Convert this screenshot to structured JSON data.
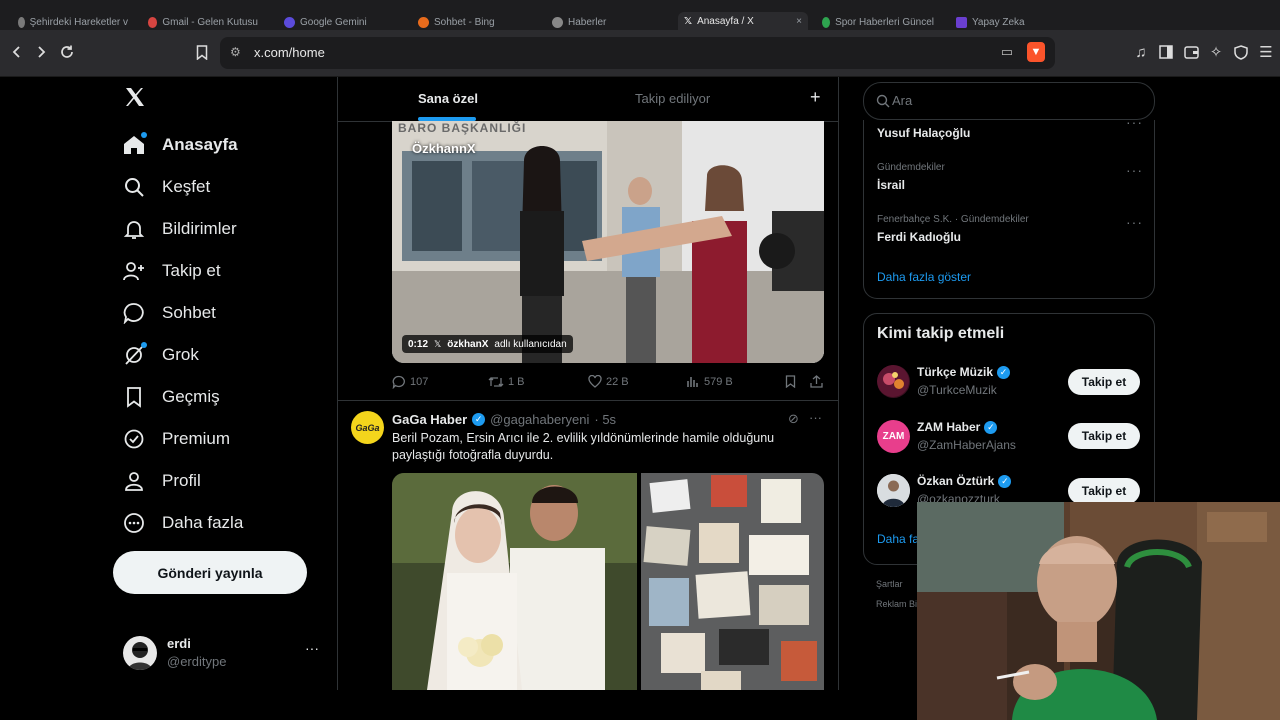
{
  "browser": {
    "tabs": [
      "Şehirdeki Hareketler v",
      "Gmail - Gelen Kutusu",
      "Google Gemini",
      "Sohbet - Bing",
      "Haberler",
      "Anasayfa / X",
      "Spor Haberleri Güncel",
      "Yapay Zeka"
    ],
    "active_tab_index": 5,
    "url": "x.com/home"
  },
  "nav": {
    "items": [
      {
        "label": "Anasayfa",
        "icon": "home-icon",
        "active": true,
        "dot": true
      },
      {
        "label": "Keşfet",
        "icon": "search-icon"
      },
      {
        "label": "Bildirimler",
        "icon": "bell-icon"
      },
      {
        "label": "Takip et",
        "icon": "add-person-icon"
      },
      {
        "label": "Sohbet",
        "icon": "chat-bubble-icon"
      },
      {
        "label": "Grok",
        "icon": "grok-icon",
        "dot": true
      },
      {
        "label": "Geçmiş",
        "icon": "bookmark-icon"
      },
      {
        "label": "Premium",
        "icon": "verified-badge-icon"
      },
      {
        "label": "Profil",
        "icon": "person-icon"
      },
      {
        "label": "Daha fazla",
        "icon": "more-circle-icon"
      }
    ],
    "post_button": "Gönderi yayınla",
    "account": {
      "name": "erdi",
      "handle": "@erditype"
    }
  },
  "feed": {
    "tabs": [
      "Sana özel",
      "Takip ediliyor"
    ],
    "active_tab": 0,
    "video_post": {
      "video_label": "ÖzkhannX",
      "sign_text": "BARO BAŞKANLIĞI",
      "duration": "0:12",
      "video_user": "özkhanX",
      "video_suffix": "adlı kullanıcıdan",
      "replies": "107",
      "reposts": "1 B",
      "likes": "22 B",
      "views": "579 B"
    },
    "news_post": {
      "avatar_text": "GaGa",
      "name": "GaGa Haber",
      "handle": "@gagahaberyeni",
      "time": "· 5s",
      "text": "Beril Pozam, Ersin Arıcı ile 2. evlilik yıldönümlerinde hamile olduğunu paylaştığı fotoğrafla duyurdu."
    }
  },
  "right": {
    "search_placeholder": "Ara",
    "trends": [
      {
        "meta": "",
        "name": "Yusuf Halaçoğlu"
      },
      {
        "meta": "Gündemdekiler",
        "name": "İsrail"
      },
      {
        "meta": "Fenerbahçe S.K. · Gündemdekiler",
        "name": "Ferdi Kadıoğlu"
      }
    ],
    "show_more": "Daha fazla göster",
    "who_to_follow": {
      "title": "Kimi takip etmeli",
      "accounts": [
        {
          "name": "Türkçe Müzik",
          "handle": "@TurkceMuzik",
          "button": "Takip et"
        },
        {
          "name": "ZAM Haber",
          "handle": "@ZamHaberAjans",
          "button": "Takip et",
          "avatar_text": "ZAM"
        },
        {
          "name": "Özkan Öztürk",
          "handle": "@ozkanozzturk",
          "button": "Takip et"
        }
      ],
      "show_more": "Daha fa"
    },
    "footer": [
      "Şartlar",
      "Reklam Bi"
    ]
  },
  "colors": {
    "accent": "#1d9bf0",
    "background": "#000000",
    "border": "#2f3336"
  }
}
